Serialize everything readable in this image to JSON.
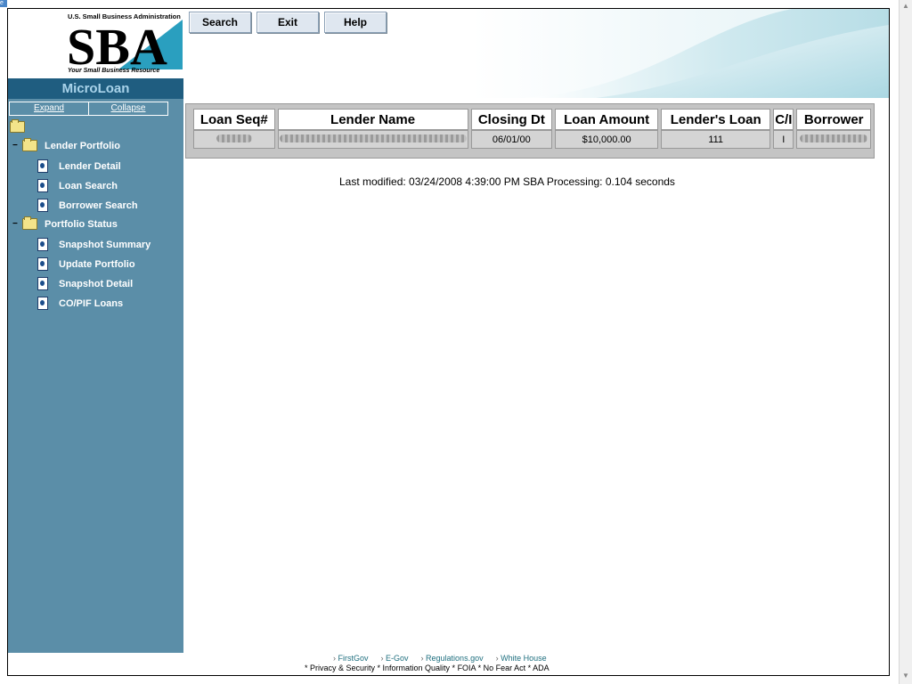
{
  "logo": {
    "agency": "U.S. Small Business Administration",
    "mark": "SBA",
    "tagline": "Your Small Business Resource"
  },
  "sidebar": {
    "app_title": "MicroLoan",
    "expand_label": "Expand",
    "collapse_label": "Collapse",
    "groups": [
      {
        "label": "Lender Portfolio",
        "items": [
          "Lender Detail",
          "Loan Search",
          "Borrower Search"
        ]
      },
      {
        "label": "Portfolio Status",
        "items": [
          "Snapshot Summary",
          "Update Portfolio",
          "Snapshot Detail",
          "CO/PIF Loans"
        ]
      }
    ]
  },
  "toolbar": {
    "search_label": "Search",
    "exit_label": "Exit",
    "help_label": "Help"
  },
  "results": {
    "headers": [
      "Loan Seq#",
      "Lender Name",
      "Closing Dt",
      "Loan Amount",
      "Lender's Loan",
      "C/I",
      "Borrower"
    ],
    "row": {
      "closing_dt": "06/01/00",
      "loan_amount": "$10,000.00",
      "lenders_loan": "111",
      "ci": "I"
    }
  },
  "status": {
    "last_modified": "Last modified: 03/24/2008 4:39:00 PM   SBA Processing:  0.104 seconds"
  },
  "footer": {
    "links": [
      "FirstGov",
      "E-Gov",
      "Regulations.gov",
      "White House"
    ],
    "legal": "* Privacy & Security  * Information Quality  * FOIA  * No Fear Act  * ADA"
  },
  "colors": {
    "sidebar_bg": "#5b8ea8",
    "title_bar": "#1f5d80",
    "link_teal": "#1f6f7f"
  }
}
